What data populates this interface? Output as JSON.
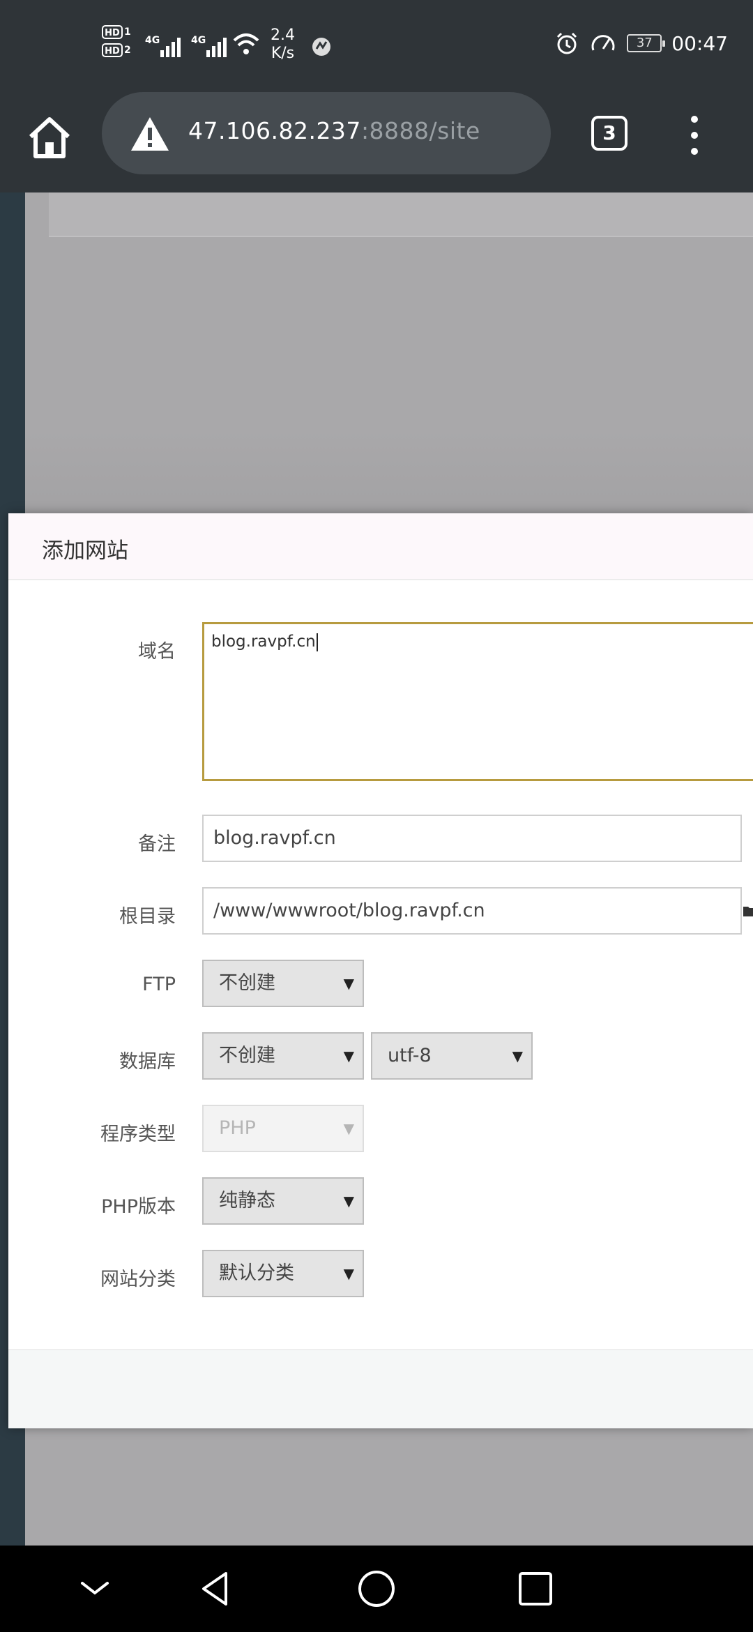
{
  "status_bar": {
    "sim1_badge": "HD",
    "sim1_index": "1",
    "sim2_badge": "HD",
    "sim2_index": "2",
    "network1": "4G",
    "network2": "4G",
    "speed_value": "2.4",
    "speed_unit": "K/s",
    "battery_level": "37",
    "time": "00:47"
  },
  "browser": {
    "url_host": "47.106.82.237",
    "url_rest": ":8888/site",
    "tab_count": "3"
  },
  "dialog": {
    "title": "添加网站",
    "fields": {
      "domain": {
        "label": "域名",
        "value": "blog.ravpf.cn"
      },
      "remark": {
        "label": "备注",
        "value": "blog.ravpf.cn"
      },
      "root": {
        "label": "根目录",
        "value": "/www/wwwroot/blog.ravpf.cn"
      },
      "ftp": {
        "label": "FTP",
        "selected": "不创建"
      },
      "database": {
        "label": "数据库",
        "selected": "不创建",
        "charset": "utf-8"
      },
      "program_type": {
        "label": "程序类型",
        "selected": "PHP",
        "disabled": true
      },
      "php_version": {
        "label": "PHP版本",
        "selected": "纯静态"
      },
      "site_category": {
        "label": "网站分类",
        "selected": "默认分类"
      }
    }
  },
  "icons": {
    "home": "home-icon",
    "warning": "warning-icon",
    "menu": "more-vert-icon",
    "folder": "folder-icon",
    "nav_collapse": "chevron-down-icon",
    "nav_back": "back-triangle-icon",
    "nav_home": "home-circle-icon",
    "nav_recent": "recents-square-icon"
  },
  "colors": {
    "chrome_dark": "#2f3438",
    "focus_border": "#b79b3f",
    "overlay": "#a9a8aa"
  }
}
